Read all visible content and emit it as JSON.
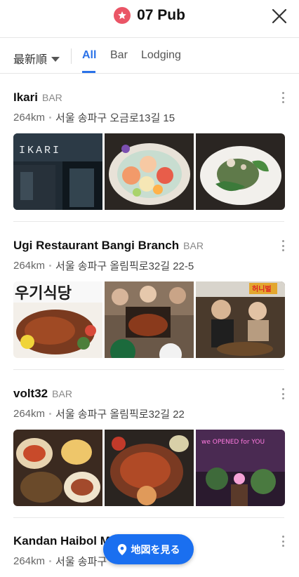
{
  "header": {
    "title": "07 Pub",
    "badge_icon": "star-icon",
    "close_icon": "close-icon"
  },
  "filters": {
    "sort_label": "最新順",
    "tabs": [
      {
        "label": "All",
        "active": true
      },
      {
        "label": "Bar",
        "active": false
      },
      {
        "label": "Lodging",
        "active": false
      }
    ]
  },
  "listings": [
    {
      "name": "Ikari",
      "category": "BAR",
      "distance": "264km",
      "address": "서울 송파구 오금로13길 15"
    },
    {
      "name": "Ugi Restaurant Bangi Branch",
      "category": "BAR",
      "distance": "264km",
      "address": "서울 송파구 올림픽로32길 22-5"
    },
    {
      "name": "volt32",
      "category": "BAR",
      "distance": "264km",
      "address": "서울 송파구 올림픽로32길 22"
    },
    {
      "name": "Kandan Haibol M",
      "category": "",
      "distance": "264km",
      "address": "서울 송파구"
    }
  ],
  "photo_text": {
    "ikari_sign": "IKARI",
    "ugi_sign": "우기식당",
    "ugi_sign2": "허니벌",
    "volt_neon": "we OPENED for YOU"
  },
  "map_button": {
    "label": "地図を見る",
    "icon": "map-pin-icon"
  },
  "colors": {
    "accent": "#2b72e8",
    "badge": "#ea5566",
    "map_button": "#1a6ff0"
  }
}
